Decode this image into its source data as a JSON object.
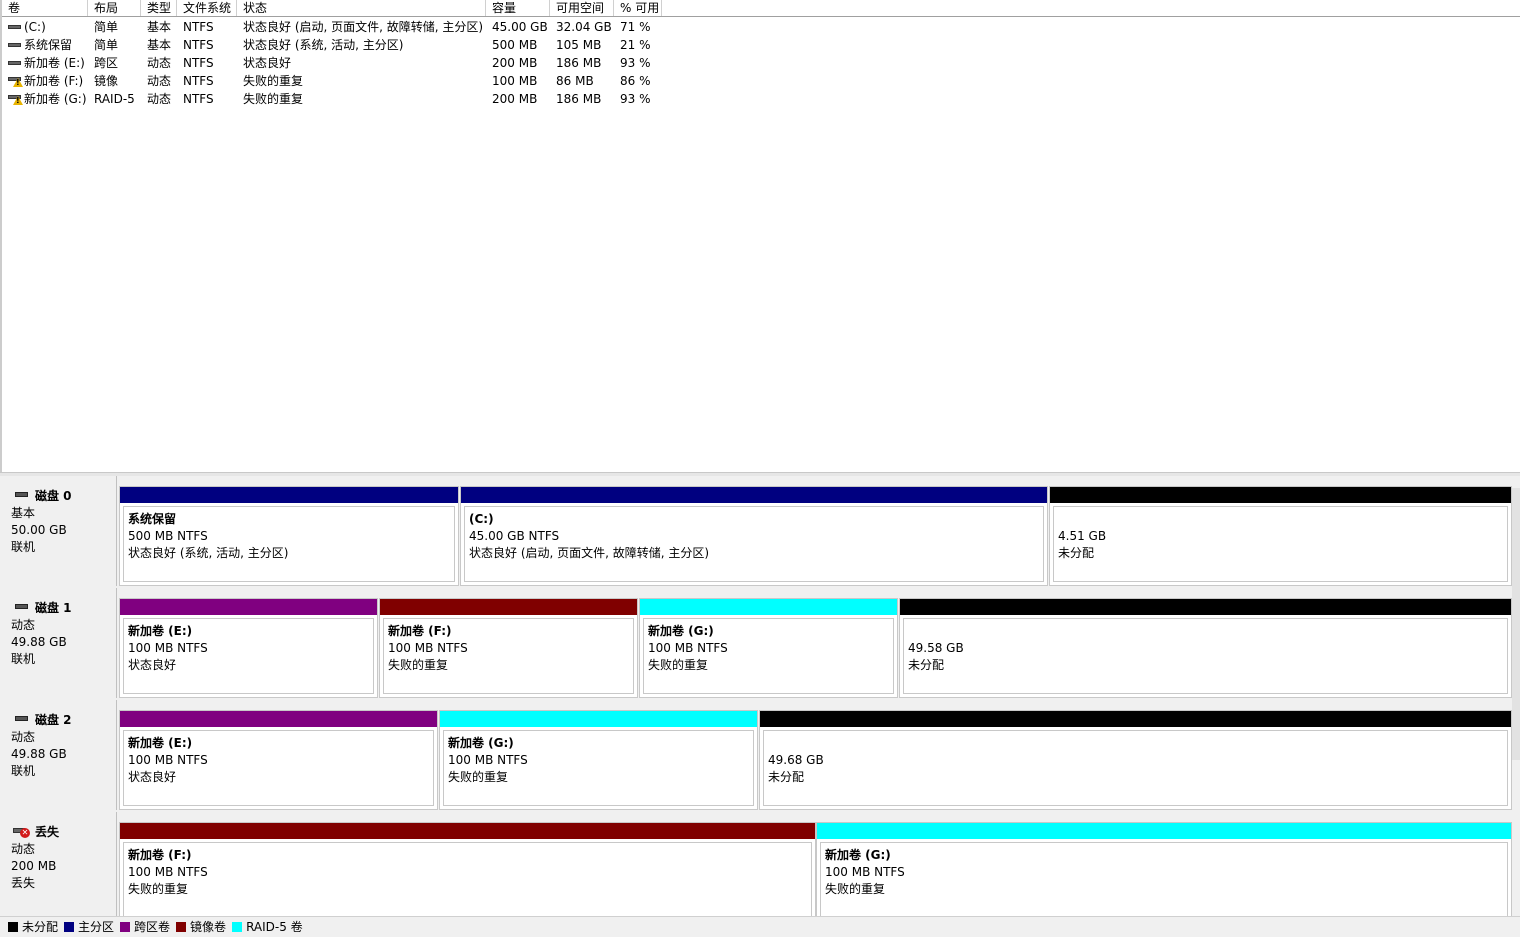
{
  "colors": {
    "unallocated": "#000000",
    "primary": "#000080",
    "spanned": "#800080",
    "mirror": "#800000",
    "raid5": "#00ffff"
  },
  "columns": [
    "卷",
    "布局",
    "类型",
    "文件系统",
    "状态",
    "容量",
    "可用空间",
    "% 可用"
  ],
  "volumes": [
    {
      "name": " (C:)",
      "layout": "简单",
      "type": "基本",
      "fs": "NTFS",
      "status": "状态良好 (启动, 页面文件, 故障转储, 主分区)",
      "capacity": "45.00 GB",
      "free": "32.04 GB",
      "pct": "71 %",
      "icon": "drive-icon"
    },
    {
      "name": "系统保留",
      "layout": "简单",
      "type": "基本",
      "fs": "NTFS",
      "status": "状态良好 (系统, 活动, 主分区)",
      "capacity": "500 MB",
      "free": "105 MB",
      "pct": "21 %",
      "icon": "drive-icon"
    },
    {
      "name": "新加卷 (E:)",
      "layout": "跨区",
      "type": "动态",
      "fs": "NTFS",
      "status": "状态良好",
      "capacity": "200 MB",
      "free": "186 MB",
      "pct": "93 %",
      "icon": "drive-icon"
    },
    {
      "name": "新加卷 (F:)",
      "layout": "镜像",
      "type": "动态",
      "fs": "NTFS",
      "status": "失败的重复",
      "capacity": "100 MB",
      "free": "86 MB",
      "pct": "86 %",
      "icon": "drive-warning-icon"
    },
    {
      "name": "新加卷 (G:)",
      "layout": "RAID-5",
      "type": "动态",
      "fs": "NTFS",
      "status": "失败的重复",
      "capacity": "200 MB",
      "free": "186 MB",
      "pct": "93 %",
      "icon": "drive-warning-icon"
    }
  ],
  "disks": [
    {
      "title": "磁盘 0",
      "type": "基本",
      "size": "50.00 GB",
      "state": "联机",
      "icon": "disk-icon",
      "partitions": [
        {
          "name": "系统保留",
          "size": "500 MB NTFS",
          "status": "状态良好 (系统, 活动, 主分区)",
          "kind": "primary"
        },
        {
          "name": " (C:)",
          "size": "45.00 GB NTFS",
          "status": "状态良好 (启动, 页面文件, 故障转储, 主分区)",
          "kind": "primary"
        },
        {
          "name": "",
          "size": "4.51 GB",
          "status": "未分配",
          "kind": "unallocated"
        }
      ]
    },
    {
      "title": "磁盘 1",
      "type": "动态",
      "size": "49.88 GB",
      "state": "联机",
      "icon": "disk-icon",
      "partitions": [
        {
          "name": "新加卷  (E:)",
          "size": "100 MB NTFS",
          "status": "状态良好",
          "kind": "spanned"
        },
        {
          "name": "新加卷  (F:)",
          "size": "100 MB NTFS",
          "status": "失败的重复",
          "kind": "mirror"
        },
        {
          "name": "新加卷  (G:)",
          "size": "100 MB NTFS",
          "status": "失败的重复",
          "kind": "raid5"
        },
        {
          "name": "",
          "size": "49.58 GB",
          "status": "未分配",
          "kind": "unallocated"
        }
      ]
    },
    {
      "title": "磁盘 2",
      "type": "动态",
      "size": "49.88 GB",
      "state": "联机",
      "icon": "disk-icon",
      "partitions": [
        {
          "name": "新加卷  (E:)",
          "size": "100 MB NTFS",
          "status": "状态良好",
          "kind": "spanned"
        },
        {
          "name": "新加卷  (G:)",
          "size": "100 MB NTFS",
          "status": "失败的重复",
          "kind": "raid5"
        },
        {
          "name": "",
          "size": "49.68 GB",
          "status": "未分配",
          "kind": "unallocated"
        }
      ]
    },
    {
      "title": "丢失",
      "type": "动态",
      "size": "200 MB",
      "state": "丢失",
      "icon": "missing-disk-icon",
      "partitions": [
        {
          "name": "新加卷  (F:)",
          "size": "100 MB NTFS",
          "status": "失败的重复",
          "kind": "mirror"
        },
        {
          "name": "新加卷  (G:)",
          "size": "100 MB NTFS",
          "status": "失败的重复",
          "kind": "raid5"
        }
      ]
    }
  ],
  "legend": [
    {
      "label": "未分配",
      "kind": "unallocated"
    },
    {
      "label": "主分区",
      "kind": "primary"
    },
    {
      "label": "跨区卷",
      "kind": "spanned"
    },
    {
      "label": "镜像卷",
      "kind": "mirror"
    },
    {
      "label": "RAID-5 卷",
      "kind": "raid5"
    }
  ]
}
